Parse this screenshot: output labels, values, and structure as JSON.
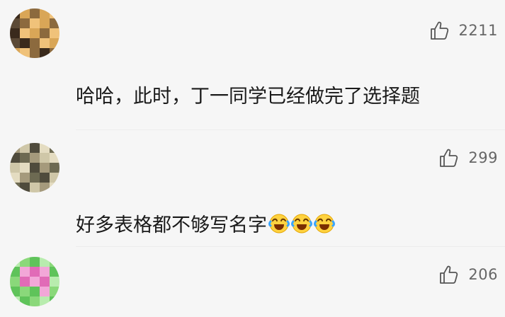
{
  "comments": [
    {
      "likes": "2211",
      "text": "哈哈，此时，丁一同学已经做完了选择题",
      "emojis": [],
      "avatar_palette": [
        "#3a2a1c",
        "#d9a657",
        "#8c6a3e",
        "#f0c27a",
        "#5c4a36"
      ]
    },
    {
      "likes": "299",
      "text": "好多表格都不够写名字",
      "emojis": [
        "laughing-crying-emoji",
        "laughing-crying-emoji",
        "laughing-crying-emoji"
      ],
      "avatar_palette": [
        "#6d6a52",
        "#a59a7c",
        "#cfc7a8",
        "#4f4b3c",
        "#e4dcc1"
      ]
    },
    {
      "likes": "206",
      "text": "",
      "emojis": [],
      "avatar_palette": [
        "#5fc35a",
        "#8ad87a",
        "#f2a7d8",
        "#e16bb7",
        "#b8ecae"
      ]
    }
  ],
  "icons": {
    "like": "thumbs-up-icon"
  }
}
